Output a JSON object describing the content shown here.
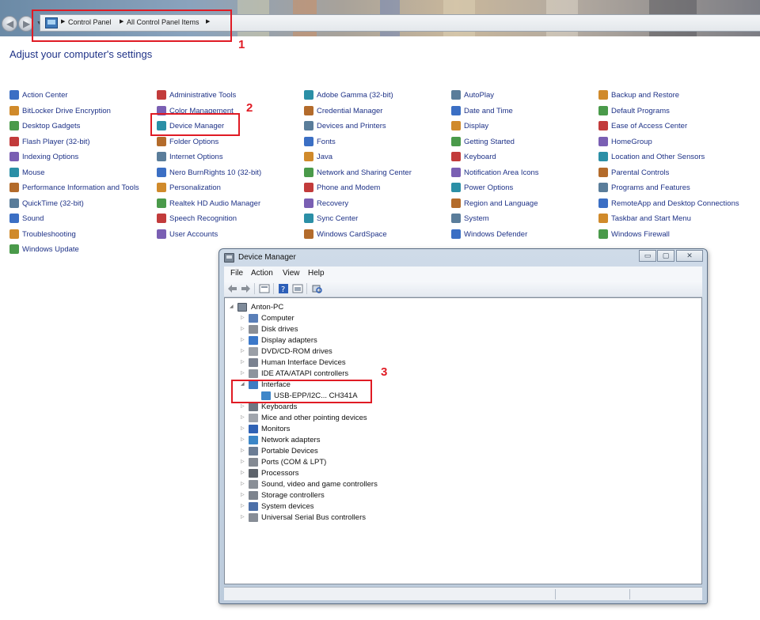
{
  "address_bar": {
    "crumbs": [
      "Control Panel",
      "All Control Panel Items"
    ]
  },
  "page_heading": "Adjust your computer's settings",
  "control_panel_items": [
    [
      "Action Center",
      "BitLocker Drive Encryption",
      "Desktop Gadgets",
      "Flash Player (32-bit)",
      "Indexing Options",
      "Mouse",
      "Performance Information and Tools",
      "QuickTime (32-bit)",
      "Sound",
      "Troubleshooting",
      "Windows Update"
    ],
    [
      "Administrative Tools",
      "Color Management",
      "Device Manager",
      "Folder Options",
      "Internet Options",
      "Nero BurnRights 10 (32-bit)",
      "Personalization",
      "Realtek HD Audio Manager",
      "Speech Recognition",
      "User Accounts"
    ],
    [
      "Adobe Gamma (32-bit)",
      "Credential Manager",
      "Devices and Printers",
      "Fonts",
      "Java",
      "Network and Sharing Center",
      "Phone and Modem",
      "Recovery",
      "Sync Center",
      "Windows CardSpace"
    ],
    [
      "AutoPlay",
      "Date and Time",
      "Display",
      "Getting Started",
      "Keyboard",
      "Notification Area Icons",
      "Power Options",
      "Region and Language",
      "System",
      "Windows Defender"
    ],
    [
      "Backup and Restore",
      "Default Programs",
      "Ease of Access Center",
      "HomeGroup",
      "Location and Other Sensors",
      "Parental Controls",
      "Programs and Features",
      "RemoteApp and Desktop Connections",
      "Taskbar and Start Menu",
      "Windows Firewall"
    ]
  ],
  "annotations": [
    "1",
    "2",
    "3"
  ],
  "device_manager": {
    "title": "Device Manager",
    "caption_buttons": [
      "▭",
      "▢",
      "✕"
    ],
    "menu": [
      "File",
      "Action",
      "View",
      "Help"
    ],
    "root": "Anton-PC",
    "categories": [
      "Computer",
      "Disk drives",
      "Display adapters",
      "DVD/CD-ROM drives",
      "Human Interface Devices",
      "IDE ATA/ATAPI controllers",
      "Interface",
      "Keyboards",
      "Mice and other pointing devices",
      "Monitors",
      "Network adapters",
      "Portable Devices",
      "Ports (COM & LPT)",
      "Processors",
      "Sound, video and game controllers",
      "Storage controllers",
      "System devices",
      "Universal Serial Bus controllers"
    ],
    "expanded_child": "USB-EPP/I2C... CH341A"
  },
  "colors": {
    "link": "#1e3287",
    "annotation_red": "#e01b24"
  }
}
